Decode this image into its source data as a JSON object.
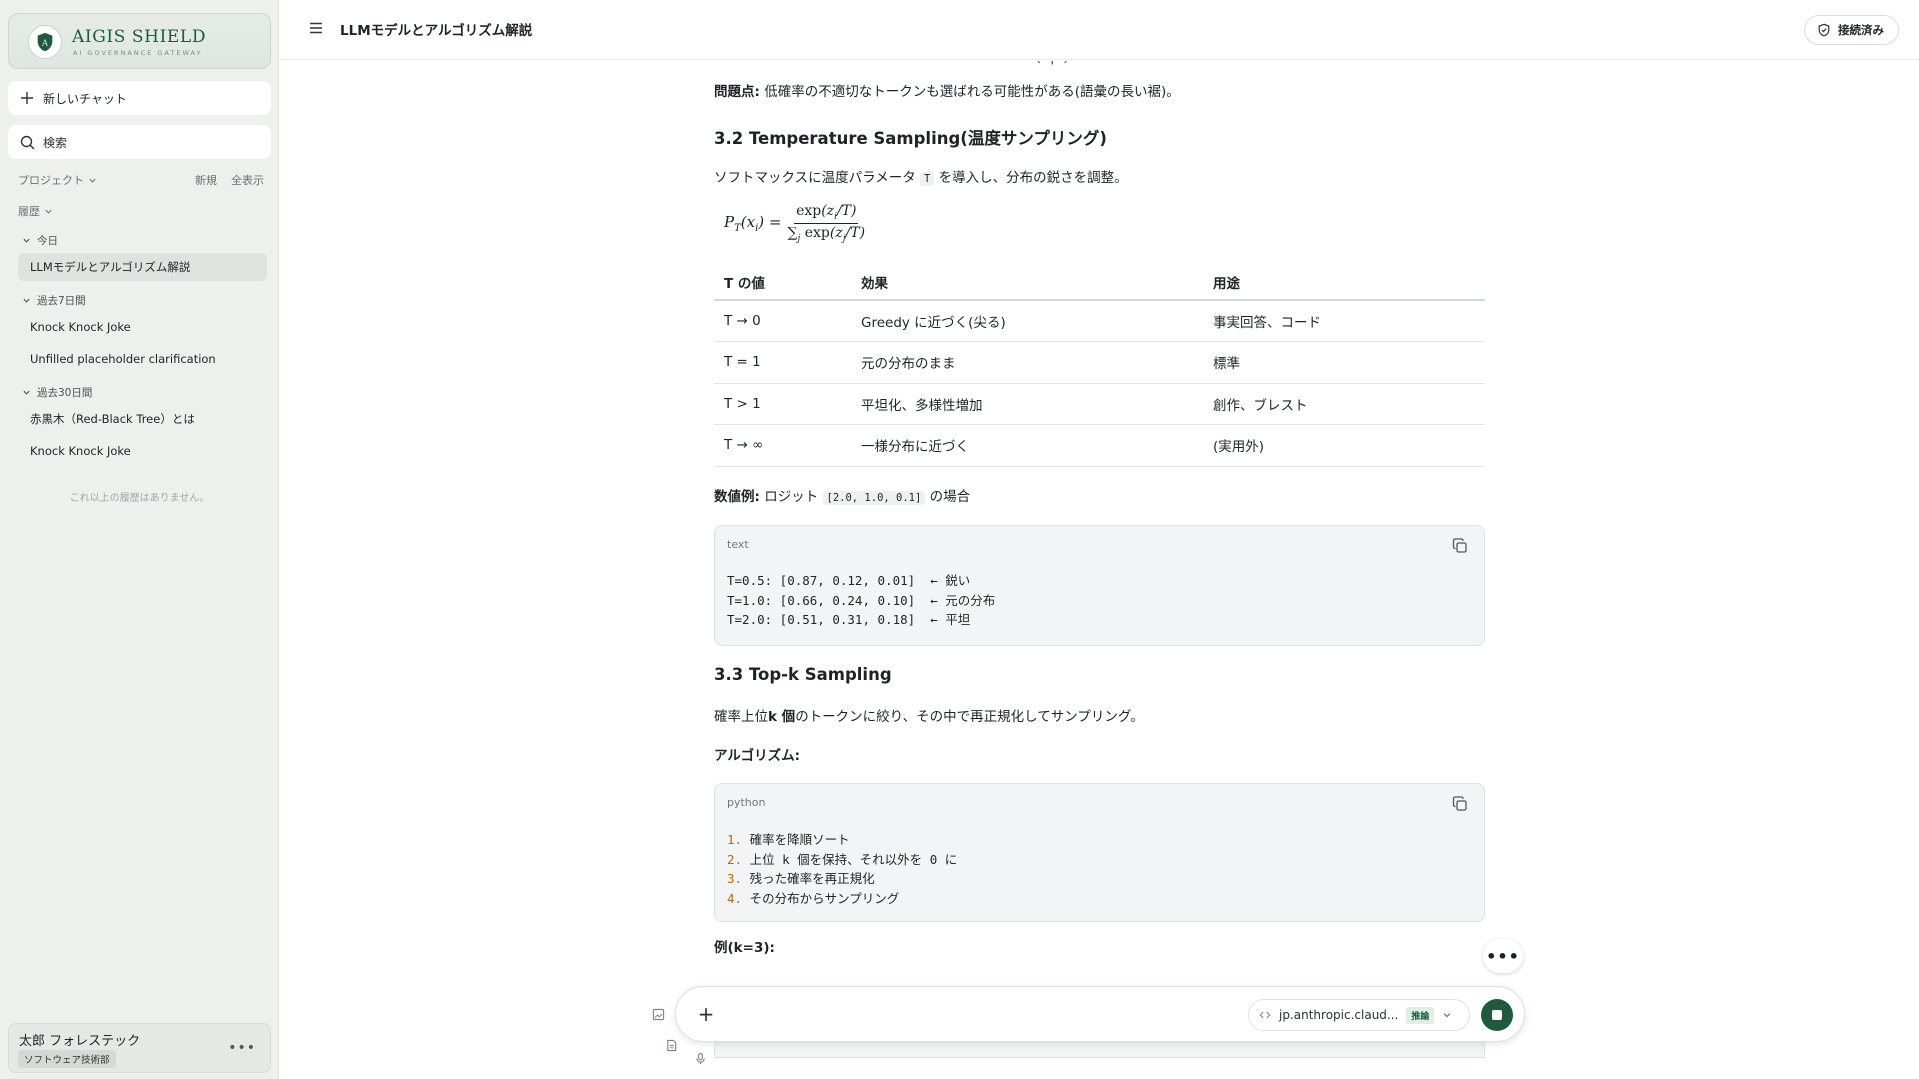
{
  "brand": {
    "name": "AIGIS SHIELD",
    "tagline": "AI GOVERNANCE GATEWAY",
    "color": "#1f5a3e"
  },
  "sidebar": {
    "new_chat": "新しいチャット",
    "search": "検索",
    "projects_label": "プロジェクト",
    "projects_new": "新規",
    "projects_all": "全表示",
    "history_label": "履歴",
    "groups": [
      {
        "label": "今日",
        "items": [
          {
            "label": "LLMモデルとアルゴリズム解説",
            "active": true
          }
        ]
      },
      {
        "label": "過去7日間",
        "items": [
          {
            "label": "Knock Knock Joke"
          },
          {
            "label": "Unfilled placeholder clarification"
          }
        ]
      },
      {
        "label": "過去30日間",
        "items": [
          {
            "label": "赤黒木（Red-Black Tree）とは"
          },
          {
            "label": "Knock Knock Joke"
          }
        ]
      }
    ],
    "no_more": "これ以上の履歴はありません。",
    "user": {
      "name": "太郎 フォレステック",
      "department": "ソフトウェア技術部"
    }
  },
  "header": {
    "title": "LLMモデルとアルゴリズム解説",
    "status": "接続済み"
  },
  "content": {
    "problem_label": "問題点:",
    "problem_text": "低確率の不適切なトークンも選ばれる可能性がある(語彙の長い裾)。",
    "temp_heading": "3.2 Temperature Sampling(温度サンプリング)",
    "temp_intro_pre": "ソフトマックスに温度パラメータ",
    "temp_intro_code": "T",
    "temp_intro_post": "を導入し、分布の鋭さを調整。",
    "table": {
      "headers": [
        "T の値",
        "効果",
        "用途"
      ],
      "rows": [
        [
          "T → 0",
          "Greedy に近づく(尖る)",
          "事実回答、コード"
        ],
        [
          "T = 1",
          "元の分布のまま",
          "標準"
        ],
        [
          "T > 1",
          "平坦化、多様性増加",
          "創作、ブレスト"
        ],
        [
          "T → ∞",
          "一様分布に近づく",
          "(実用外)"
        ]
      ]
    },
    "example_label": "数値例:",
    "example_pre": "ロジット",
    "example_code": "[2.0, 1.0, 0.1]",
    "example_post": "の場合",
    "code1": {
      "lang": "text",
      "lines": [
        "T=0.5: [0.87, 0.12, 0.01]  ← 鋭い",
        "T=1.0: [0.66, 0.24, 0.10]  ← 元の分布",
        "T=2.0: [0.51, 0.31, 0.18]  ← 平坦"
      ]
    },
    "topk_heading": "3.3 Top-k Sampling",
    "topk_pre": "確率上位",
    "topk_bold": "k 個",
    "topk_post": "のトークンに絞り、その中で再正規化してサンプリング。",
    "algo_label": "アルゴリズム:",
    "code2": {
      "lang": "python",
      "lines": [
        "確率を降順ソート",
        "上位 k 個を保持、それ以外を 0 に",
        "残った確率を再正規化",
        "その分布からサンプリング"
      ],
      "numbers": [
        "1.",
        "2.",
        "3.",
        "4."
      ]
    },
    "example2_label": "例(k=3):"
  },
  "composer": {
    "model": "jp.anthropic.claud...",
    "badge": "推論"
  }
}
